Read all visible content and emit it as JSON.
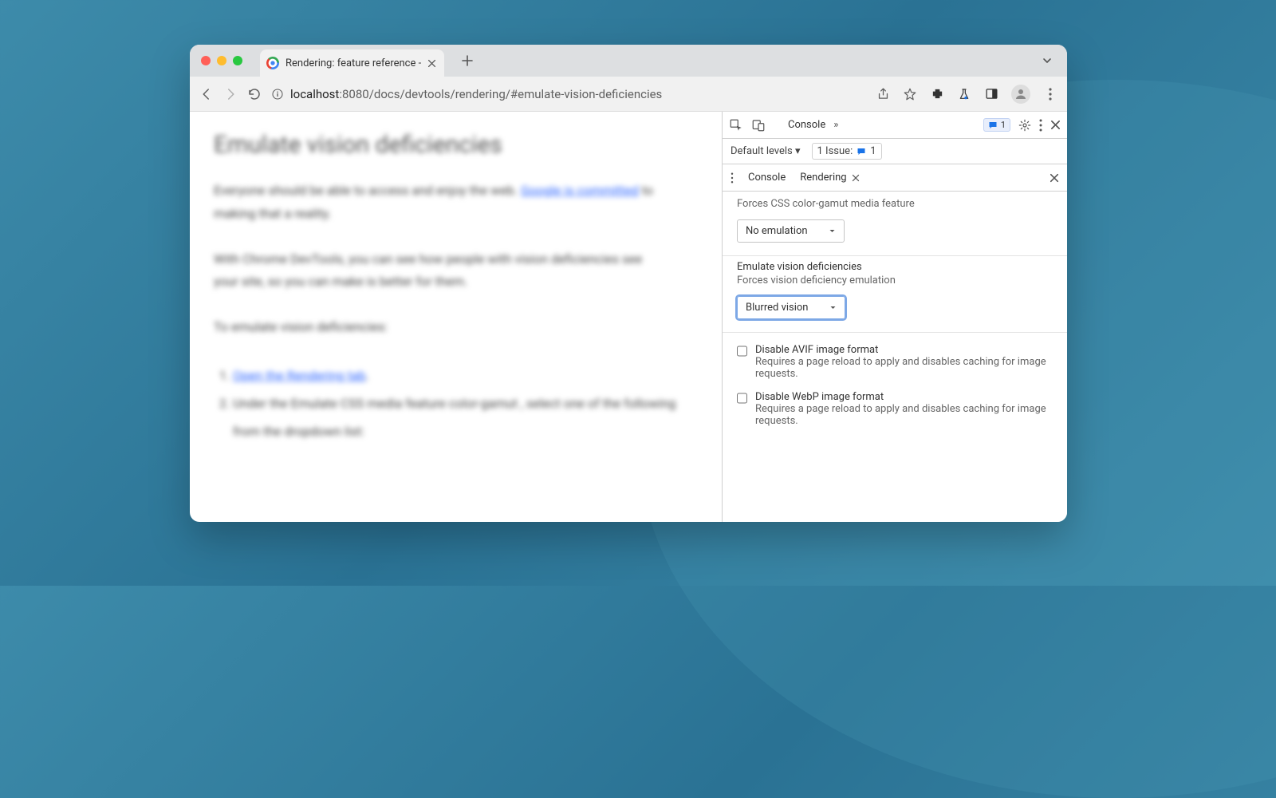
{
  "window": {
    "traffic": {
      "close": "#ff5f57",
      "min": "#febc2e",
      "max": "#28c840"
    },
    "tab_title": "Rendering: feature reference -",
    "url": {
      "info": "ⓘ",
      "host": "localhost",
      "port": ":8080",
      "path": "/docs/devtools/rendering/#emulate-vision-deficiencies"
    }
  },
  "page": {
    "h1": "Emulate vision deficiencies",
    "p1a": "Everyone should be able to access and enjoy the web. ",
    "p1_link": "Google is committed",
    "p1b": " to making that a reality.",
    "p2": "With Chrome DevTools, you can see how people with vision deficiencies see your site, so you can make is better for them.",
    "p3": "To emulate vision deficiencies:",
    "step1_link": "Open the Rendering tab",
    "step1_dot": ".",
    "step2a": "Under the Emulate CSS media feature ",
    "step2_code": "color-gamut",
    "step2b": " , select one of the following from the dropdown list:"
  },
  "devtools": {
    "top_tab": "Console",
    "more": "»",
    "badge_count": "1",
    "gear": "⚙",
    "row2_levels": "Default levels ▾",
    "row2_issue": "1 Issue:",
    "row2_issue_count": "1",
    "drawer_tab1": "Console",
    "drawer_tab2": "Rendering",
    "section_gamut_desc": "Forces CSS color-gamut media feature",
    "gamut_select": "No emulation",
    "vision_title": "Emulate vision deficiencies",
    "vision_desc": "Forces vision deficiency emulation",
    "vision_select": "Blurred vision",
    "avif_title": "Disable AVIF image format",
    "avif_desc": "Requires a page reload to apply and disables caching for image requests.",
    "webp_title": "Disable WebP image format",
    "webp_desc": "Requires a page reload to apply and disables caching for image requests."
  }
}
